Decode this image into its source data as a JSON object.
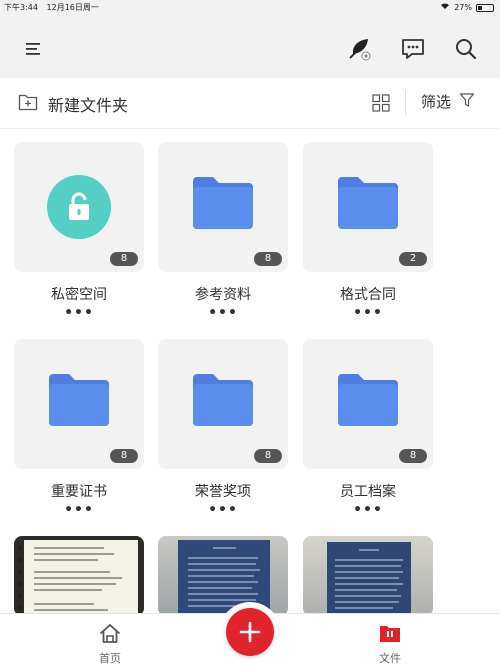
{
  "status_bar": {
    "time": "下午3:44",
    "date": "12月16日周一",
    "battery": "27%"
  },
  "top_bar": {
    "icons": [
      "menu-icon",
      "feather-icon",
      "chat-icon",
      "search-icon"
    ]
  },
  "toolbar": {
    "new_folder_label": "新建文件夹",
    "filter_label": "筛选"
  },
  "folders": [
    {
      "name": "私密空间",
      "count": "8",
      "icon": "lock-icon",
      "more": "•••"
    },
    {
      "name": "参考资料",
      "count": "8",
      "icon": "folder-icon",
      "more": "•••"
    },
    {
      "name": "格式合同",
      "count": "2",
      "icon": "folder-icon",
      "more": "•••"
    },
    {
      "name": "重要证书",
      "count": "8",
      "icon": "folder-icon",
      "more": "•••"
    },
    {
      "name": "荣誉奖项",
      "count": "8",
      "icon": "folder-icon",
      "more": "•••"
    },
    {
      "name": "员工档案",
      "count": "8",
      "icon": "folder-icon",
      "more": "•••"
    }
  ],
  "bottom_nav": {
    "home_label": "首页",
    "files_label": "文件"
  },
  "colors": {
    "accent": "#e0242d",
    "folder": "#5b8def",
    "lock": "#55cfc4",
    "background": "#f2f2f2"
  }
}
